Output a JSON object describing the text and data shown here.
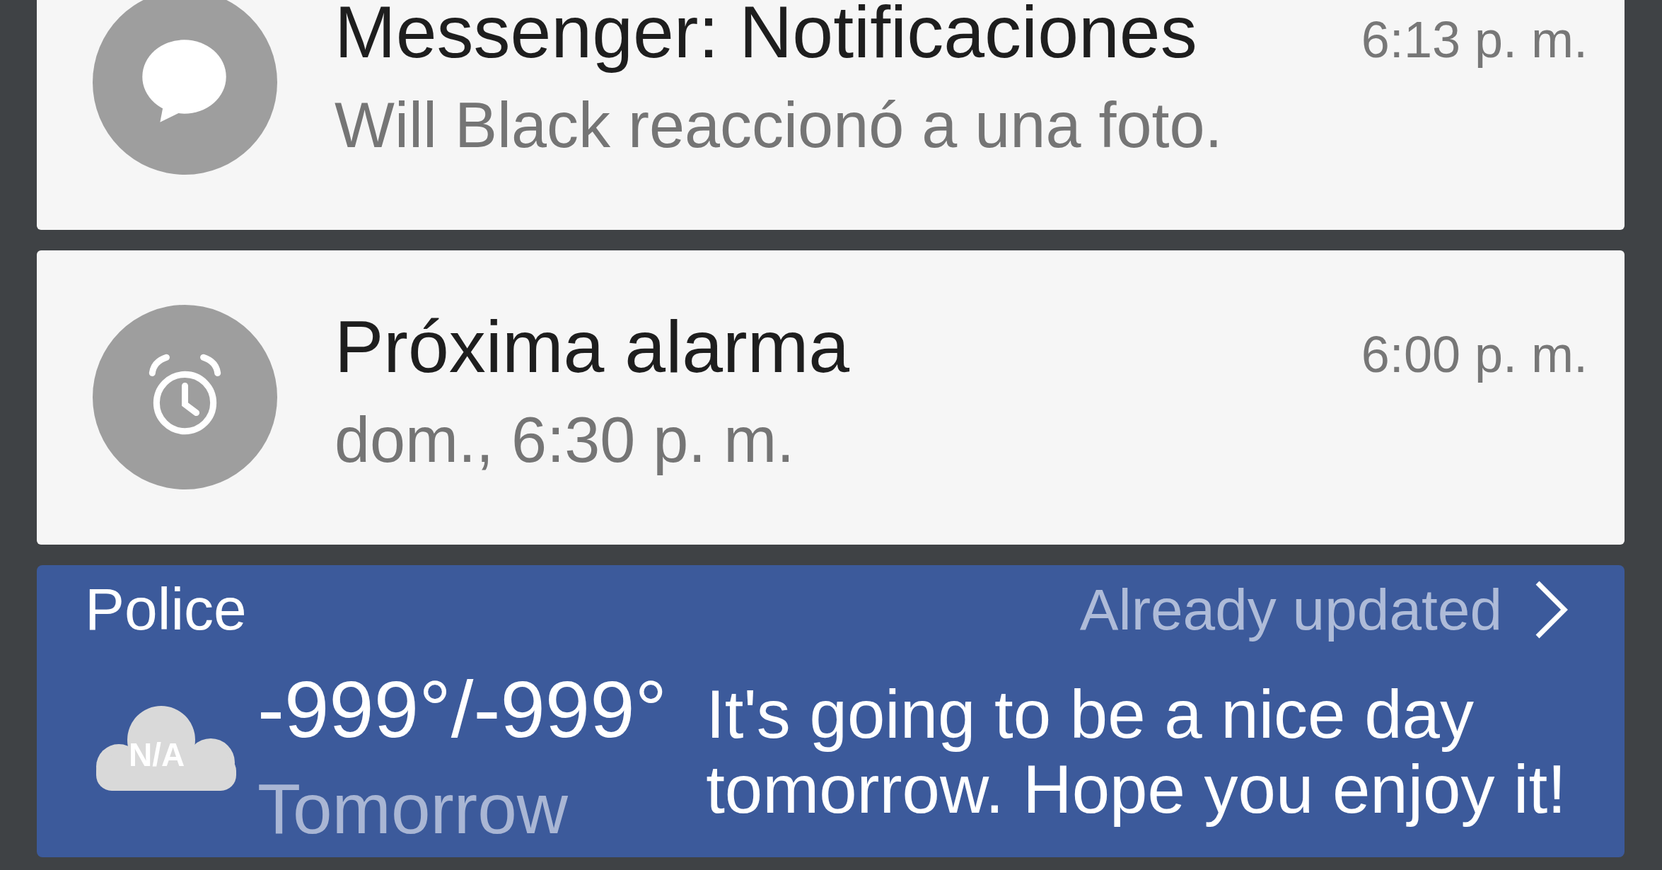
{
  "notifications": [
    {
      "kind": "message",
      "title": "Messenger: Notificaciones",
      "text": "Will Black reaccionó a una foto.",
      "time": "6:13 p. m."
    },
    {
      "kind": "alarm",
      "title": "Próxima alarma",
      "text": "dom., 6:30 p. m.",
      "time": "6:00 p. m."
    }
  ],
  "weather_widget": {
    "location": "Police",
    "status": "Already updated",
    "condition_label": "N/A",
    "temperature": "-999°/-999°",
    "day": "Tomorrow",
    "message": "It's going to be a nice day tomorrow. Hope you enjoy it!"
  }
}
